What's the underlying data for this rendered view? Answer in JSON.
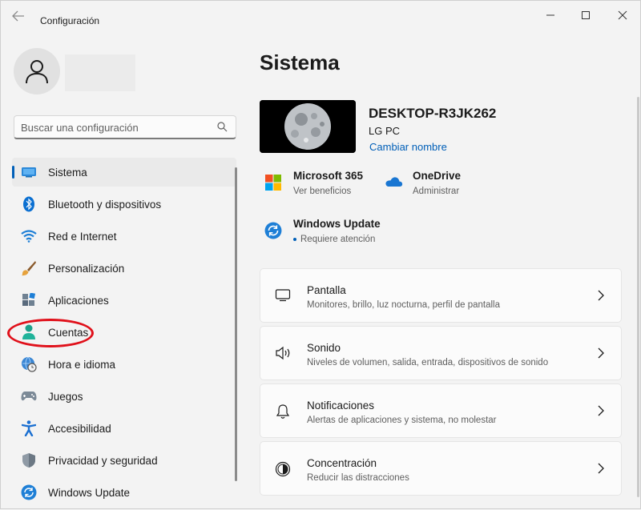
{
  "window": {
    "title": "Configuración"
  },
  "search": {
    "placeholder": "Buscar una configuración"
  },
  "sidebar": {
    "items": [
      {
        "label": "Sistema",
        "icon": "monitor-icon",
        "active": true
      },
      {
        "label": "Bluetooth y dispositivos",
        "icon": "bluetooth-icon"
      },
      {
        "label": "Red e Internet",
        "icon": "wifi-icon"
      },
      {
        "label": "Personalización",
        "icon": "brush-icon"
      },
      {
        "label": "Aplicaciones",
        "icon": "apps-icon"
      },
      {
        "label": "Cuentas",
        "icon": "person-icon"
      },
      {
        "label": "Hora e idioma",
        "icon": "clock-globe-icon"
      },
      {
        "label": "Juegos",
        "icon": "gamepad-icon"
      },
      {
        "label": "Accesibilidad",
        "icon": "accessibility-icon"
      },
      {
        "label": "Privacidad y seguridad",
        "icon": "shield-icon"
      },
      {
        "label": "Windows Update",
        "icon": "update-icon"
      }
    ]
  },
  "main": {
    "title": "Sistema",
    "device": {
      "name": "DESKTOP-R3JK262",
      "model": "LG PC",
      "rename": "Cambiar nombre"
    },
    "quick": {
      "m365": {
        "title": "Microsoft 365",
        "sub": "Ver beneficios"
      },
      "onedrive": {
        "title": "OneDrive",
        "sub": "Administrar"
      },
      "update": {
        "title": "Windows Update",
        "sub": "Requiere atención"
      }
    },
    "cards": [
      {
        "title": "Pantalla",
        "sub": "Monitores, brillo, luz nocturna, perfil de pantalla",
        "icon": "display-icon"
      },
      {
        "title": "Sonido",
        "sub": "Niveles de volumen, salida, entrada, dispositivos de sonido",
        "icon": "speaker-icon"
      },
      {
        "title": "Notificaciones",
        "sub": "Alertas de aplicaciones y sistema, no molestar",
        "icon": "bell-icon"
      },
      {
        "title": "Concentración",
        "sub": "Reducir las distracciones",
        "icon": "focus-icon"
      }
    ]
  },
  "colors": {
    "accent": "#005fb8",
    "annotation": "#e0101a"
  }
}
